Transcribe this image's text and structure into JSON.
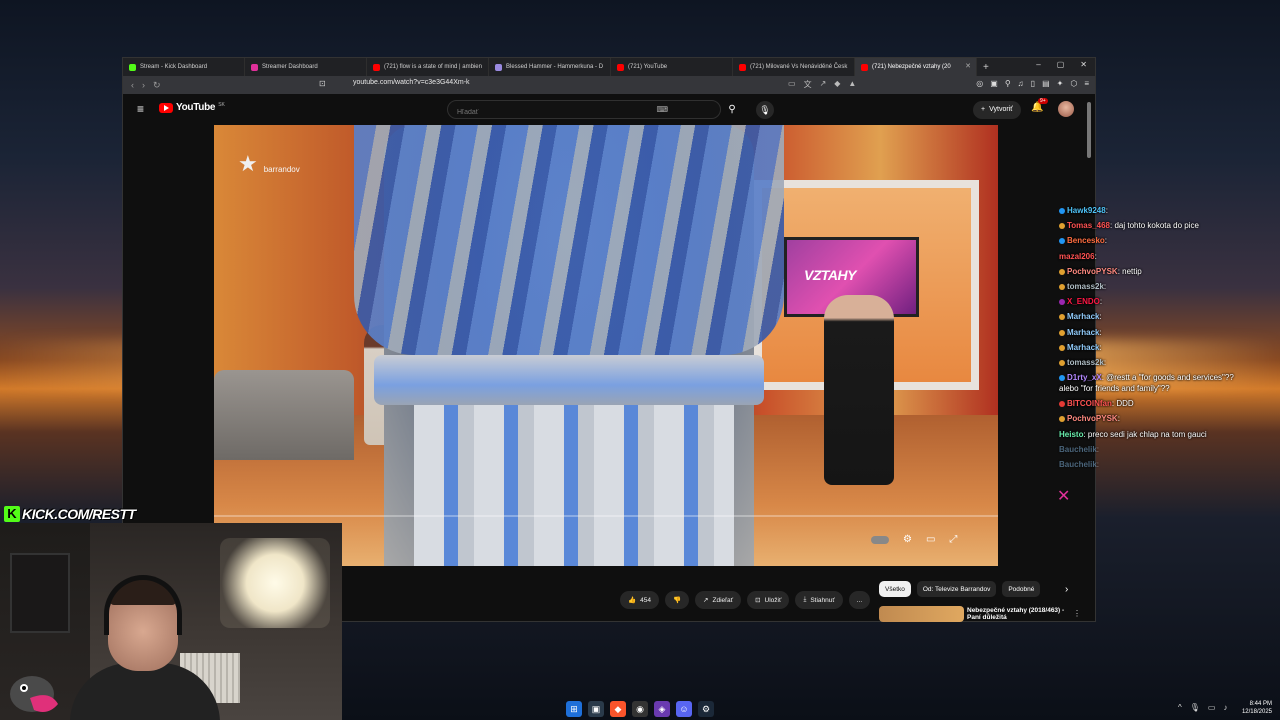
{
  "browser": {
    "tabs": [
      {
        "title": "Stream - Kick Dashboard",
        "color": "#53fc18"
      },
      {
        "title": "Streamer Dashboard",
        "color": "#e0309a"
      },
      {
        "title": "(721) flow is a state of mind | ambien",
        "color": "#ff0000"
      },
      {
        "title": "Blessed Hammer - Hammerkuna - D",
        "color": "#9a8ae0"
      },
      {
        "title": "(721) YouTube",
        "color": "#ff0000"
      },
      {
        "title": "(721) Milované Vs Nenáviděné Česk",
        "color": "#ff0000"
      },
      {
        "title": "(721) Nebezpečné vztahy (20",
        "color": "#ff0000",
        "active": true
      }
    ],
    "url": "youtube.com/watch?v=c3e3G44Xm-k",
    "new_tab": "+",
    "window_controls": [
      "–",
      "▢",
      "✕"
    ]
  },
  "youtube": {
    "logo_text": "YouTube",
    "country": "SK",
    "search_placeholder": "Hľadať",
    "create_label": "Vytvoriť",
    "notifications": "9+",
    "video": {
      "channel_watermark": "barrandov",
      "tv_text": "VZTAHY"
    },
    "actions": {
      "likes": "454",
      "share": "Zdieľať",
      "save": "Uložiť",
      "download": "Stiahnuť",
      "more": "..."
    },
    "chips": [
      "Všetko",
      "Od: Televize Barrandov",
      "Podobné"
    ],
    "recommendation": {
      "title": "Nebezpečné vztahy (2018/463) - Paní důležitá"
    }
  },
  "chat": [
    {
      "user": "Hawk9248",
      "text": "",
      "color": "#4fc3f7",
      "badge": "#2196f3"
    },
    {
      "user": "Tomas_468",
      "text": "daj tohto kokota do pice",
      "color": "#ff5252",
      "badge": "#e0a030"
    },
    {
      "user": "Bencesko",
      "text": "",
      "color": "#ff6e40",
      "badge": "#2196f3"
    },
    {
      "user": "mazal206",
      "text": "",
      "color": "#ff5252",
      "badge": ""
    },
    {
      "user": "PochvoPYSK",
      "text": "nettip",
      "color": "#ff8a80",
      "badge": "#e0a030"
    },
    {
      "user": "tomass2k",
      "text": "",
      "color": "#b0bec5",
      "badge": "#e0a030"
    },
    {
      "user": "X_ENDO",
      "text": "",
      "color": "#ff1744",
      "badge": "#9c27b0"
    },
    {
      "user": "Marhack",
      "text": "",
      "color": "#90caf9",
      "badge": "#e0a030"
    },
    {
      "user": "Marhack",
      "text": "",
      "color": "#90caf9",
      "badge": "#e0a030"
    },
    {
      "user": "Marhack",
      "text": "",
      "color": "#90caf9",
      "badge": "#e0a030"
    },
    {
      "user": "tomass2k",
      "text": "",
      "color": "#b0bec5",
      "badge": "#e0a030"
    },
    {
      "user": "D1rty_xX",
      "text": "@restt a \"for goods and services\"?? alebo \"for friends and family\"??",
      "color": "#b388ff",
      "badge": "#2196f3",
      "wrap": true
    },
    {
      "user": "BITCOINfan",
      "text": "DDD",
      "color": "#ff5252",
      "badge": "#e53935"
    },
    {
      "user": "PochvoPYSK",
      "text": "",
      "color": "#ff8a80",
      "badge": "#e0a030"
    },
    {
      "user": "Heisto",
      "text": "preco sedi jak chlap na tom gauci",
      "color": "#69f0ae",
      "badge": ""
    },
    {
      "user": "Bauchelik",
      "text": "",
      "color": "#90caf9",
      "badge": "",
      "faded": true
    },
    {
      "user": "Bauchelik",
      "text": "",
      "color": "#90caf9",
      "badge": "",
      "faded": true
    }
  ],
  "overlay": {
    "kick_letter": "K",
    "kick_url": "KICK.COM/RESTT"
  },
  "taskbar": {
    "time": "8:44 PM",
    "date": "12/18/2025"
  }
}
